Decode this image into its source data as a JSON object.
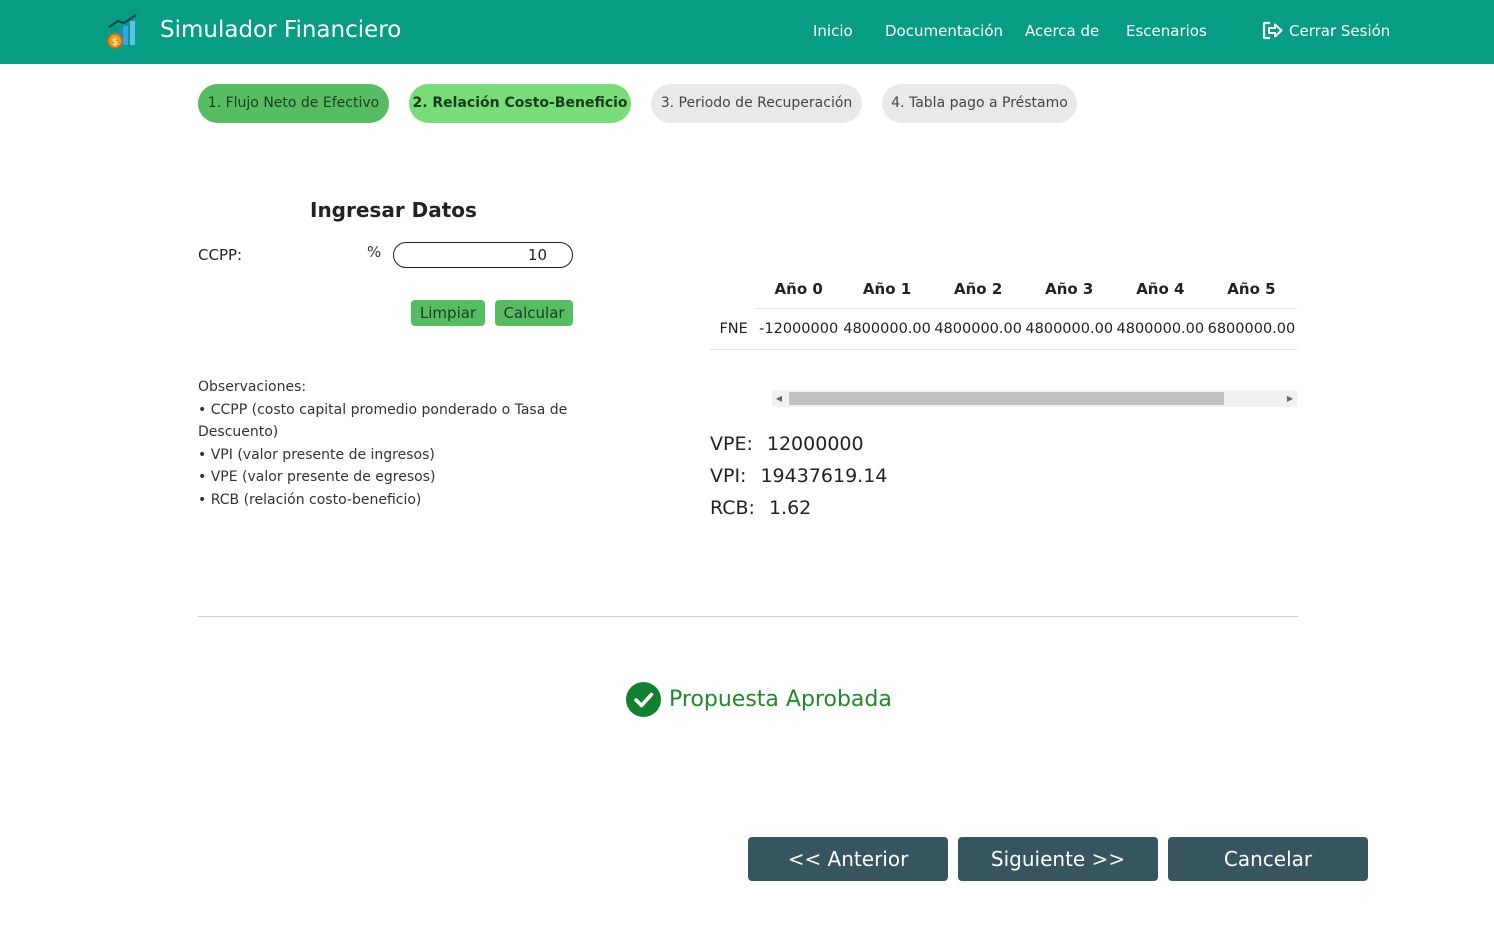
{
  "header": {
    "brand_title": "Simulador Financiero",
    "logo_icon": "financial-chart-coin-icon",
    "nav": [
      {
        "label": "Inicio"
      },
      {
        "label": "Documentación"
      },
      {
        "label": "Acerca de"
      },
      {
        "label": "Escenarios"
      }
    ],
    "logout_label": "Cerrar Sesión",
    "logout_icon": "sign-out-icon",
    "bg_color": "#079d85"
  },
  "steps": [
    {
      "label": "1. Flujo Neto de Efectivo",
      "state": "done"
    },
    {
      "label": "2. Relación Costo-Beneficio",
      "state": "active"
    },
    {
      "label": "3. Periodo de Recuperación",
      "state": "todo"
    },
    {
      "label": "4. Tabla pago a Préstamo",
      "state": "todo"
    }
  ],
  "form": {
    "title": "Ingresar Datos",
    "ccpp_label": "CCPP:",
    "unit": "%",
    "ccpp_value": "10",
    "clear_label": "Limpiar",
    "calc_label": "Calcular"
  },
  "observations": {
    "title": "Observaciones:",
    "items": [
      "CCPP (costo capital promedio ponderado o Tasa de Descuento)",
      "VPI (valor presente de ingresos)",
      "VPE (valor presente de egresos)",
      "RCB (relación costo-beneficio)"
    ]
  },
  "table": {
    "headers": [
      "Año 0",
      "Año 1",
      "Año 2",
      "Año 3",
      "Año 4",
      "Año 5"
    ],
    "row_label": "FNE",
    "values": [
      "-12000000",
      "4800000.00",
      "4800000.00",
      "4800000.00",
      "4800000.00",
      "6800000.00"
    ]
  },
  "results": {
    "vpe_label": "VPE:",
    "vpe_value": "12000000",
    "vpi_label": "VPI:",
    "vpi_value": "19437619.14",
    "rcb_label": "RCB:",
    "rcb_value": "1.62"
  },
  "status": {
    "icon": "check-circle-icon",
    "text": "Propuesta Aprobada",
    "color": "#21892c"
  },
  "footer": {
    "prev_label": "<< Anterior",
    "next_label": "Siguiente >>",
    "cancel_label": "Cancelar"
  }
}
